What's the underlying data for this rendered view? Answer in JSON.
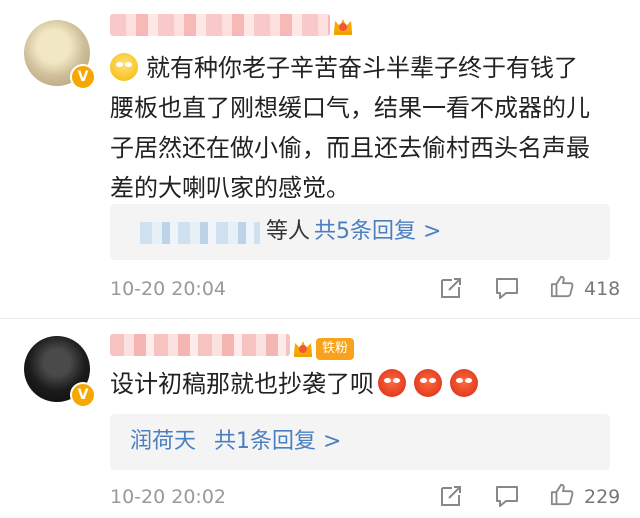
{
  "comments": [
    {
      "verified_badge": "V",
      "text_lines": [
        "就有种你老子辛苦奋斗半辈子终于有钱了",
        "腰板也直了刚想缓口气，结果一看不成器的儿",
        "子居然还在做小偷，而且还去偷村西头名声最",
        "差的大喇叭家的感觉。"
      ],
      "lead_emoji": "rolling-eyes",
      "reply_suffix": "等人",
      "reply_link": "共5条回复 >",
      "timestamp": "10-20 20:04",
      "likes": "418"
    },
    {
      "verified_badge": "V",
      "fan_tag": "铁粉",
      "text_lines": [
        "设计初稿那就也抄袭了呗"
      ],
      "trailing_emojis": [
        "angry-face",
        "angry-face",
        "angry-face"
      ],
      "reply_name": "润荷天",
      "reply_link": "共1条回复 >",
      "timestamp": "10-20 20:02",
      "likes": "229"
    }
  ],
  "colors": {
    "link": "#4a7fc1",
    "meta": "#999999",
    "fan_tag": "#f9a21b",
    "badge": "#f7a700"
  }
}
